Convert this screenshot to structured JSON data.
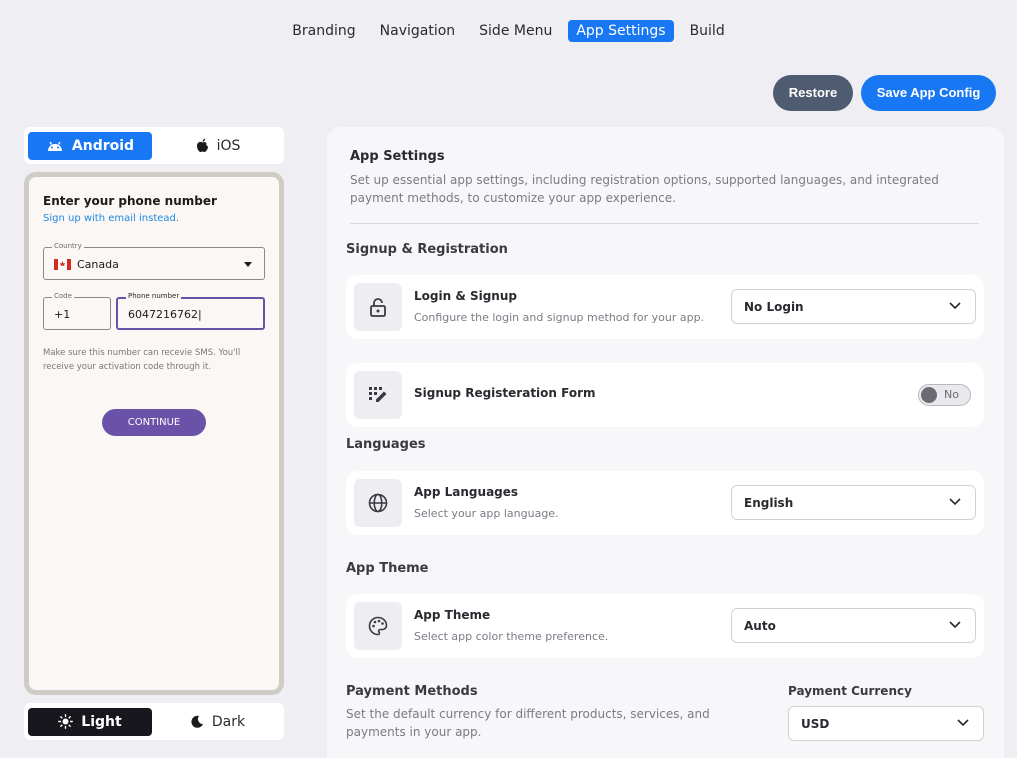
{
  "top_tabs": [
    "Branding",
    "Navigation",
    "Side Menu",
    "App Settings",
    "Build"
  ],
  "active_tab": "App Settings",
  "actions": {
    "restore": "Restore",
    "save": "Save App Config"
  },
  "os_toggle": {
    "android": "Android",
    "ios": "iOS",
    "selected": "Android"
  },
  "theme_toggle": {
    "light": "Light",
    "dark": "Dark",
    "selected": "Light"
  },
  "phone": {
    "title": "Enter your phone number",
    "email_link": "Sign up with email instead.",
    "country_label": "Country",
    "country_value": "Canada",
    "code_label": "Code",
    "code_value": "+1",
    "phone_label": "Phone number",
    "phone_value": "6047216762|",
    "help_text": "Make sure this number can recevie SMS. You'll receive your activation code through it.",
    "continue": "CONTINUE"
  },
  "panel": {
    "title": "App Settings",
    "description": "Set up essential app settings, including registration options, supported languages, and integrated payment methods, to customize your app experience.",
    "signup_section": "Signup & Registration",
    "login_card": {
      "title": "Login & Signup",
      "subtitle": "Configure the login and signup method for your app.",
      "value": "No Login"
    },
    "signup_form_card": {
      "title": "Signup Registeration Form",
      "toggle": "No"
    },
    "languages_section": "Languages",
    "languages_card": {
      "title": "App Languages",
      "subtitle": "Select your app language.",
      "value": "English"
    },
    "theme_section": "App Theme",
    "theme_card": {
      "title": "App Theme",
      "subtitle": "Select app color theme preference.",
      "value": "Auto"
    },
    "payment_section": "Payment Methods",
    "payment_desc": "Set the default currency for different products, services, and payments in your app.",
    "payment_currency_label": "Payment Currency",
    "payment_currency_value": "USD"
  },
  "colors": {
    "accent": "#1877f2",
    "restore": "#4f5b70",
    "phone_primary": "#6a52a8"
  },
  "icons": [
    "android-icon",
    "apple-icon",
    "sun-icon",
    "moon-icon",
    "lock-icon",
    "form-edit-icon",
    "globe-icon",
    "palette-icon",
    "chevron-down-icon",
    "canada-flag-icon"
  ]
}
